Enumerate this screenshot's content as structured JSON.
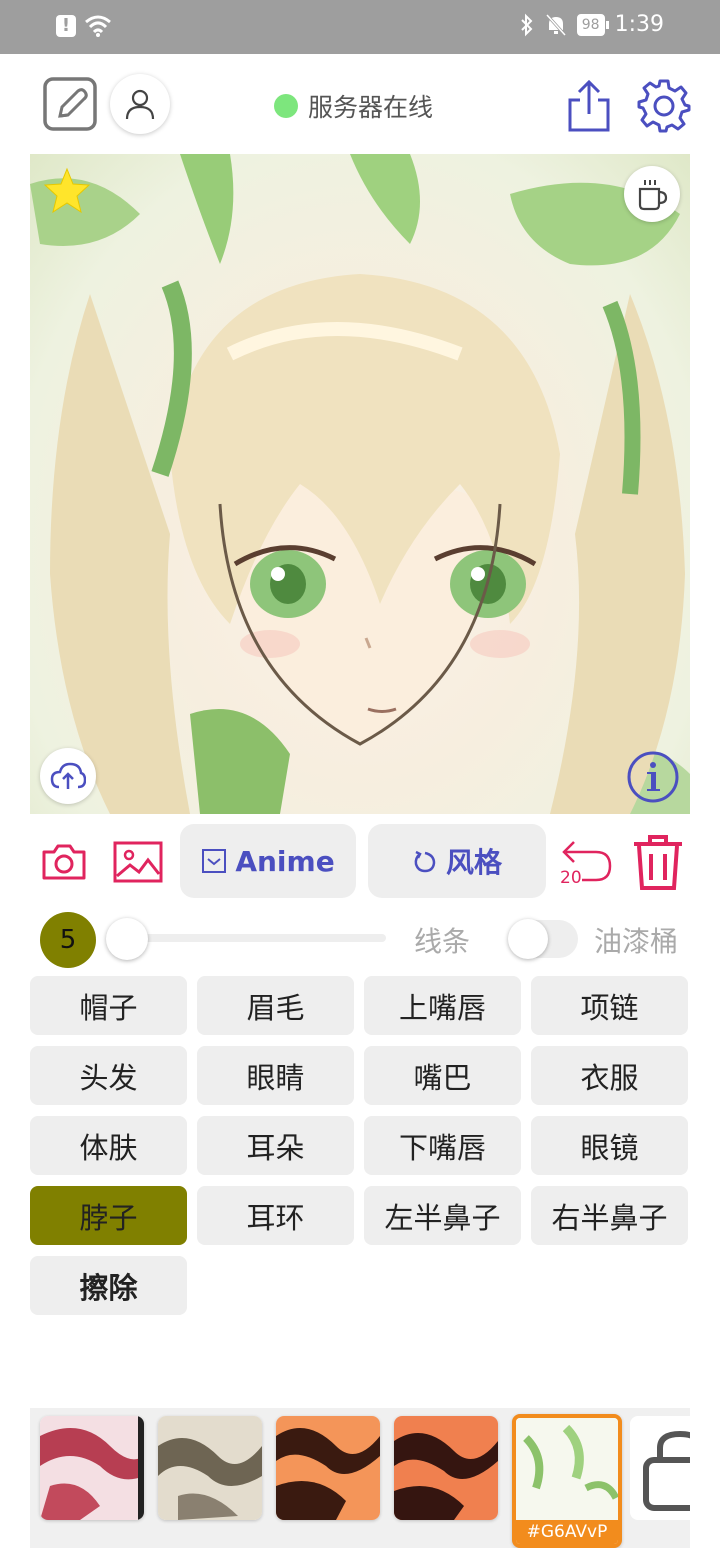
{
  "status_bar": {
    "time": "1:39",
    "battery": "98",
    "icons": [
      "alert-icon",
      "wifi-icon",
      "bluetooth-icon",
      "mute-icon",
      "battery-icon"
    ]
  },
  "header": {
    "server_status": "服务器在线",
    "server_status_color": "#7de67d",
    "icons": [
      "edit-icon",
      "user-icon",
      "share-icon",
      "settings-icon"
    ]
  },
  "canvas": {
    "overlay_icons": [
      "star-icon",
      "coffee-icon",
      "upload-icon",
      "info-icon"
    ]
  },
  "tools": {
    "anime_label": "Anime",
    "style_label": "风格",
    "undo_count": "20",
    "accent": "#4b4fc0",
    "danger": "#e0245e"
  },
  "brush": {
    "size": "5",
    "slider_fraction": 0.0,
    "lines_label": "线条",
    "bucket_label": "油漆桶",
    "bucket_enabled": false,
    "size_color": "#808000"
  },
  "parts": [
    {
      "label": "帽子"
    },
    {
      "label": "眉毛"
    },
    {
      "label": "上嘴唇"
    },
    {
      "label": "项链"
    },
    {
      "label": "头发"
    },
    {
      "label": "眼睛"
    },
    {
      "label": "嘴巴"
    },
    {
      "label": "衣服"
    },
    {
      "label": "体肤"
    },
    {
      "label": "耳朵"
    },
    {
      "label": "下嘴唇"
    },
    {
      "label": "眼镜"
    },
    {
      "label": "脖子",
      "selected": true
    },
    {
      "label": "耳环"
    },
    {
      "label": "左半鼻子"
    },
    {
      "label": "右半鼻子"
    },
    {
      "label": "擦除"
    }
  ],
  "swatches": {
    "selected_tag": "#G6AVvP",
    "selected_color": "#f28c1d"
  }
}
